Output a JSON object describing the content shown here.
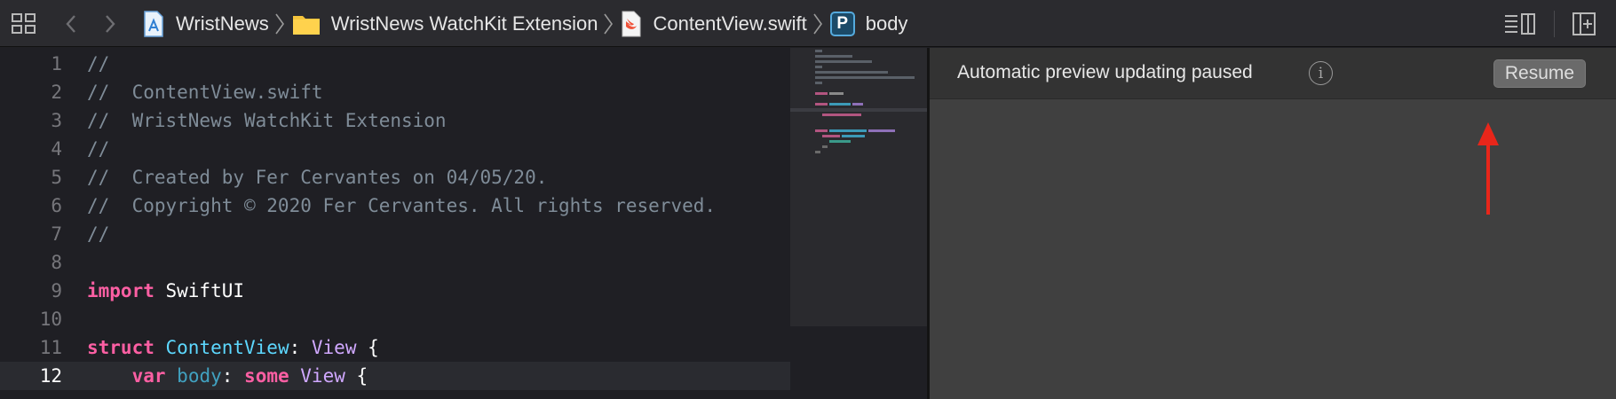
{
  "breadcrumbs": [
    {
      "label": "WristNews",
      "icon": "xcode-project-icon"
    },
    {
      "label": "WristNews WatchKit Extension",
      "icon": "folder-icon"
    },
    {
      "label": "ContentView.swift",
      "icon": "swift-file-icon"
    },
    {
      "label": "body",
      "icon": "property-icon",
      "badge": "P"
    }
  ],
  "editor": {
    "current_line": 12,
    "lines": [
      {
        "n": "1",
        "tokens": [
          [
            "c",
            "//"
          ]
        ]
      },
      {
        "n": "2",
        "tokens": [
          [
            "c",
            "//  ContentView.swift"
          ]
        ]
      },
      {
        "n": "3",
        "tokens": [
          [
            "c",
            "//  WristNews WatchKit Extension"
          ]
        ]
      },
      {
        "n": "4",
        "tokens": [
          [
            "c",
            "//"
          ]
        ]
      },
      {
        "n": "5",
        "tokens": [
          [
            "c",
            "//  Created by Fer Cervantes on 04/05/20."
          ]
        ]
      },
      {
        "n": "6",
        "tokens": [
          [
            "c",
            "//  Copyright © 2020 Fer Cervantes. All rights reserved."
          ]
        ]
      },
      {
        "n": "7",
        "tokens": [
          [
            "c",
            "//"
          ]
        ]
      },
      {
        "n": "8",
        "tokens": []
      },
      {
        "n": "9",
        "tokens": [
          [
            "k",
            "import"
          ],
          [
            "p",
            " SwiftUI"
          ]
        ]
      },
      {
        "n": "10",
        "tokens": []
      },
      {
        "n": "11",
        "tokens": [
          [
            "k",
            "struct"
          ],
          [
            "p",
            " "
          ],
          [
            "t",
            "ContentView"
          ],
          [
            "p",
            ": "
          ],
          [
            "v",
            "View"
          ],
          [
            "p",
            " {"
          ]
        ]
      },
      {
        "n": "12",
        "tokens": [
          [
            "p",
            "    "
          ],
          [
            "k",
            "var"
          ],
          [
            "p",
            " "
          ],
          [
            "r",
            "body"
          ],
          [
            "p",
            ": "
          ],
          [
            "k",
            "some"
          ],
          [
            "p",
            " "
          ],
          [
            "v",
            "View"
          ],
          [
            "p",
            " {"
          ]
        ]
      }
    ]
  },
  "preview": {
    "status_text": "Automatic preview updating paused",
    "resume_label": "Resume"
  },
  "colors": {
    "comment": "#7f8c98",
    "keyword": "#fc5fa3",
    "type": "#5dd8ff",
    "annotation_arrow": "#e8261a"
  },
  "icons": [
    "related-items-icon",
    "back-arrow-icon",
    "forward-arrow-icon",
    "chevron-right-icon",
    "info-icon",
    "editor-options-icon",
    "add-editor-icon"
  ]
}
